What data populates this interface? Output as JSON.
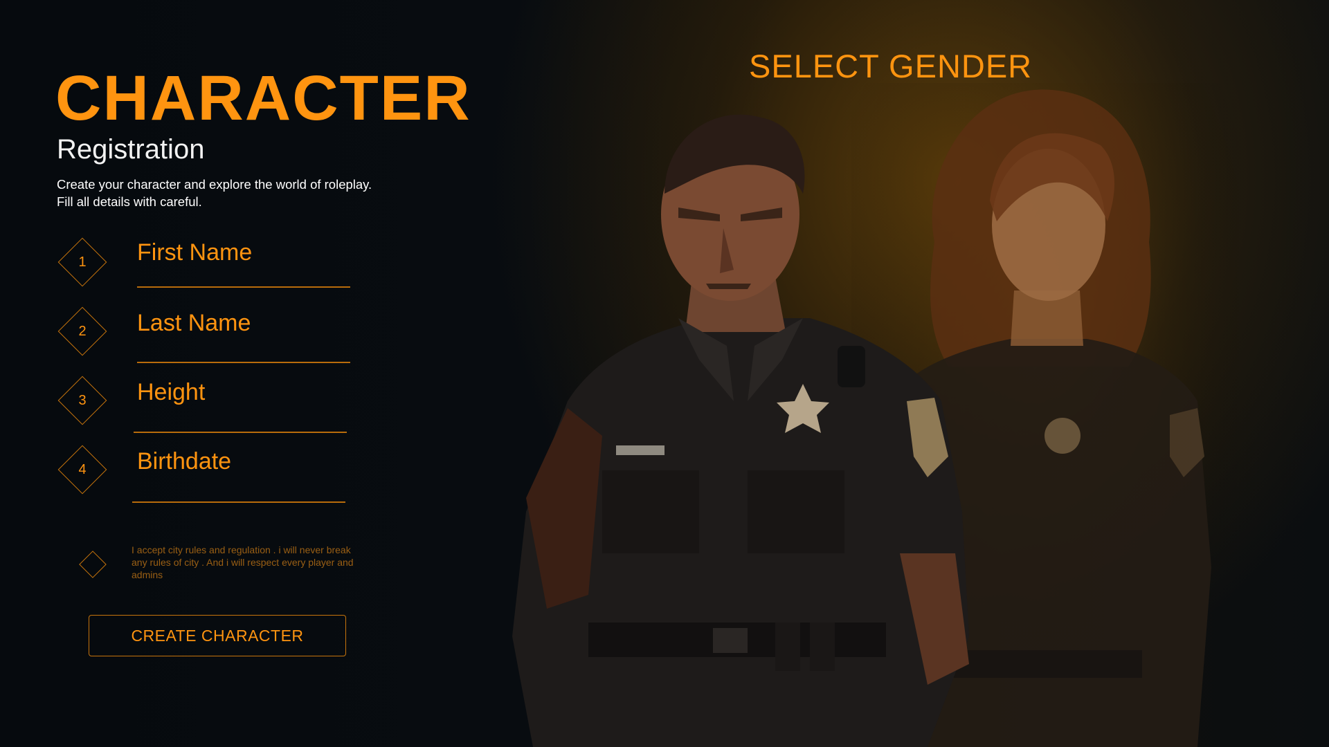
{
  "left": {
    "title": "CHARACTER",
    "subtitle": "Registration",
    "description": [
      "Create your character and explore the world of roleplay.",
      "Fill all details with careful."
    ],
    "fields": [
      {
        "number": "1",
        "placeholder": "First Name"
      },
      {
        "number": "2",
        "placeholder": "Last Name"
      },
      {
        "number": "3",
        "placeholder": "Height"
      },
      {
        "number": "4",
        "placeholder": "Birthdate"
      }
    ],
    "accept_text": "I accept city rules and regulation . i will never break any rules of city . And i will respect every player and admins",
    "create_button": "CREATE CHARACTER"
  },
  "right": {
    "title": "SELECT GENDER",
    "characters": [
      {
        "id": "male",
        "icon": "male-police-officer"
      },
      {
        "id": "female",
        "icon": "female-police-officer"
      }
    ]
  },
  "colors": {
    "accent": "#ff9410",
    "accent_dim": "#c8750c",
    "background": "#070b0f",
    "text": "#ffffff"
  }
}
